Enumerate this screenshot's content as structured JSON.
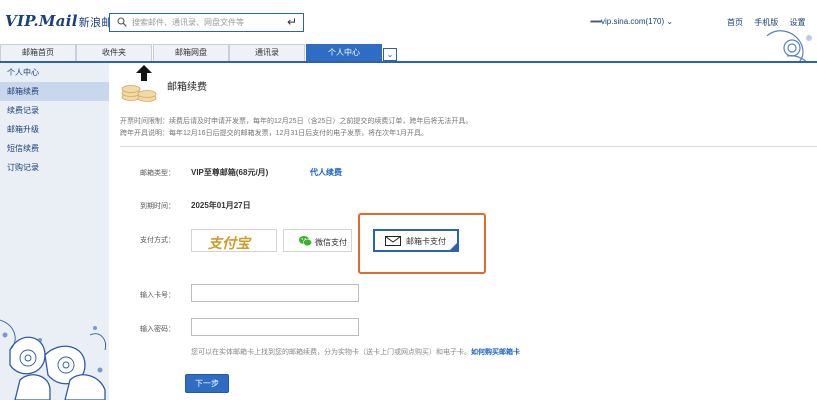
{
  "header": {
    "logo": "VIP.Mail",
    "logo_sub": "新浪邮箱",
    "search_placeholder": "搜索邮件、通讯录、网盘文件等",
    "enter_icon": "↵",
    "user_masked": "▪▪▪▪▪▪",
    "user_account": "vip.sina.com(170)",
    "user_caret": "⌄",
    "links": [
      "首页",
      "手机版",
      "设置"
    ]
  },
  "tabs": {
    "items": [
      "邮箱首页",
      "收件夹",
      "邮箱网盘",
      "通讯录",
      "个人中心"
    ],
    "active_index": 4,
    "dropdown_icon": "⌄"
  },
  "sidebar": {
    "items": [
      "个人中心",
      "邮箱续费",
      "续费记录",
      "邮箱升级",
      "短信续费",
      "订购记录"
    ],
    "active_index": 1
  },
  "main": {
    "title": "邮箱续费",
    "notice_line1": "开票时间限制：续费后请及时申请开发票，每年的12月25日（含25日）之前提交的续费订单，跨年后将无法开具。",
    "notice_line2": "跨年开具说明：每年12月16日后提交的邮箱发票，12月31日后支付的电子发票，将在次年1月开具。",
    "type_label": "邮箱类型：",
    "type_value": "VIP至尊邮箱(68元/月)",
    "agent_link": "代人续费",
    "expiry_label": "到期时间：",
    "expiry_value": "2025年01月27日",
    "pay_label": "支付方式：",
    "pay_options": [
      "支付宝",
      "微信支付",
      "邮箱卡支付"
    ],
    "pay_selected_index": 2,
    "card_no_label": "输入卡号：",
    "card_no_value": "",
    "password_label": "输入密码：",
    "password_value": "",
    "hint_text": "您可以在实体邮箱卡上找到您的邮箱续费，分为实物卡（送卡上门或网点购买）和电子卡。",
    "hint_link": "如何购买邮箱卡",
    "next_button": "下一步"
  },
  "colors": {
    "accent": "#2f6dc4",
    "sidebar_bg": "#eaeef5",
    "highlight": "#e06a2a",
    "link": "#1b64c6"
  }
}
